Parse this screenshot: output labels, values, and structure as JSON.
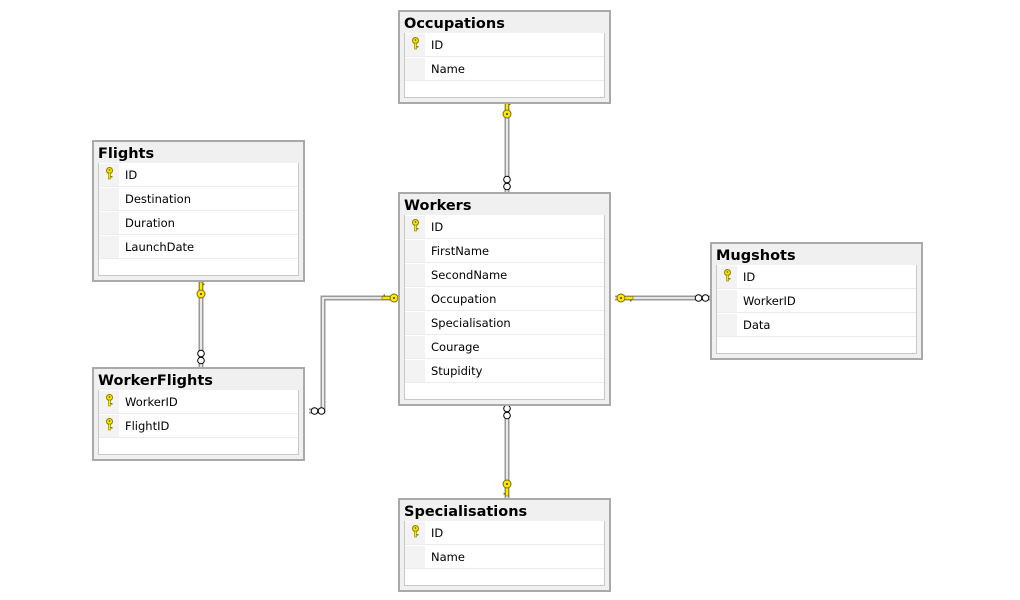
{
  "colors": {
    "key": "#ffe800",
    "line": "#a0a0a0",
    "title_bg": "#f0f0f0"
  },
  "tables": [
    {
      "name": "Occupations",
      "columns": [
        {
          "name": "ID",
          "pk": true
        },
        {
          "name": "Name",
          "pk": false
        }
      ]
    },
    {
      "name": "Flights",
      "columns": [
        {
          "name": "ID",
          "pk": true
        },
        {
          "name": "Destination",
          "pk": false
        },
        {
          "name": "Duration",
          "pk": false
        },
        {
          "name": "LaunchDate",
          "pk": false
        }
      ]
    },
    {
      "name": "Workers",
      "columns": [
        {
          "name": "ID",
          "pk": true
        },
        {
          "name": "FirstName",
          "pk": false
        },
        {
          "name": "SecondName",
          "pk": false
        },
        {
          "name": "Occupation",
          "pk": false
        },
        {
          "name": "Specialisation",
          "pk": false
        },
        {
          "name": "Courage",
          "pk": false
        },
        {
          "name": "Stupidity",
          "pk": false
        }
      ]
    },
    {
      "name": "Mugshots",
      "columns": [
        {
          "name": "ID",
          "pk": true
        },
        {
          "name": "WorkerID",
          "pk": false
        },
        {
          "name": "Data",
          "pk": false
        }
      ]
    },
    {
      "name": "WorkerFlights",
      "columns": [
        {
          "name": "WorkerID",
          "pk": true
        },
        {
          "name": "FlightID",
          "pk": true
        }
      ]
    },
    {
      "name": "Specialisations",
      "columns": [
        {
          "name": "ID",
          "pk": true
        },
        {
          "name": "Name",
          "pk": false
        }
      ]
    }
  ],
  "relationships": [
    {
      "one": "Occupations",
      "many": "Workers"
    },
    {
      "one": "Flights",
      "many": "WorkerFlights"
    },
    {
      "one": "Workers",
      "many": "WorkerFlights"
    },
    {
      "one": "Workers",
      "many": "Mugshots"
    },
    {
      "one": "Specialisations",
      "many": "Workers"
    }
  ]
}
